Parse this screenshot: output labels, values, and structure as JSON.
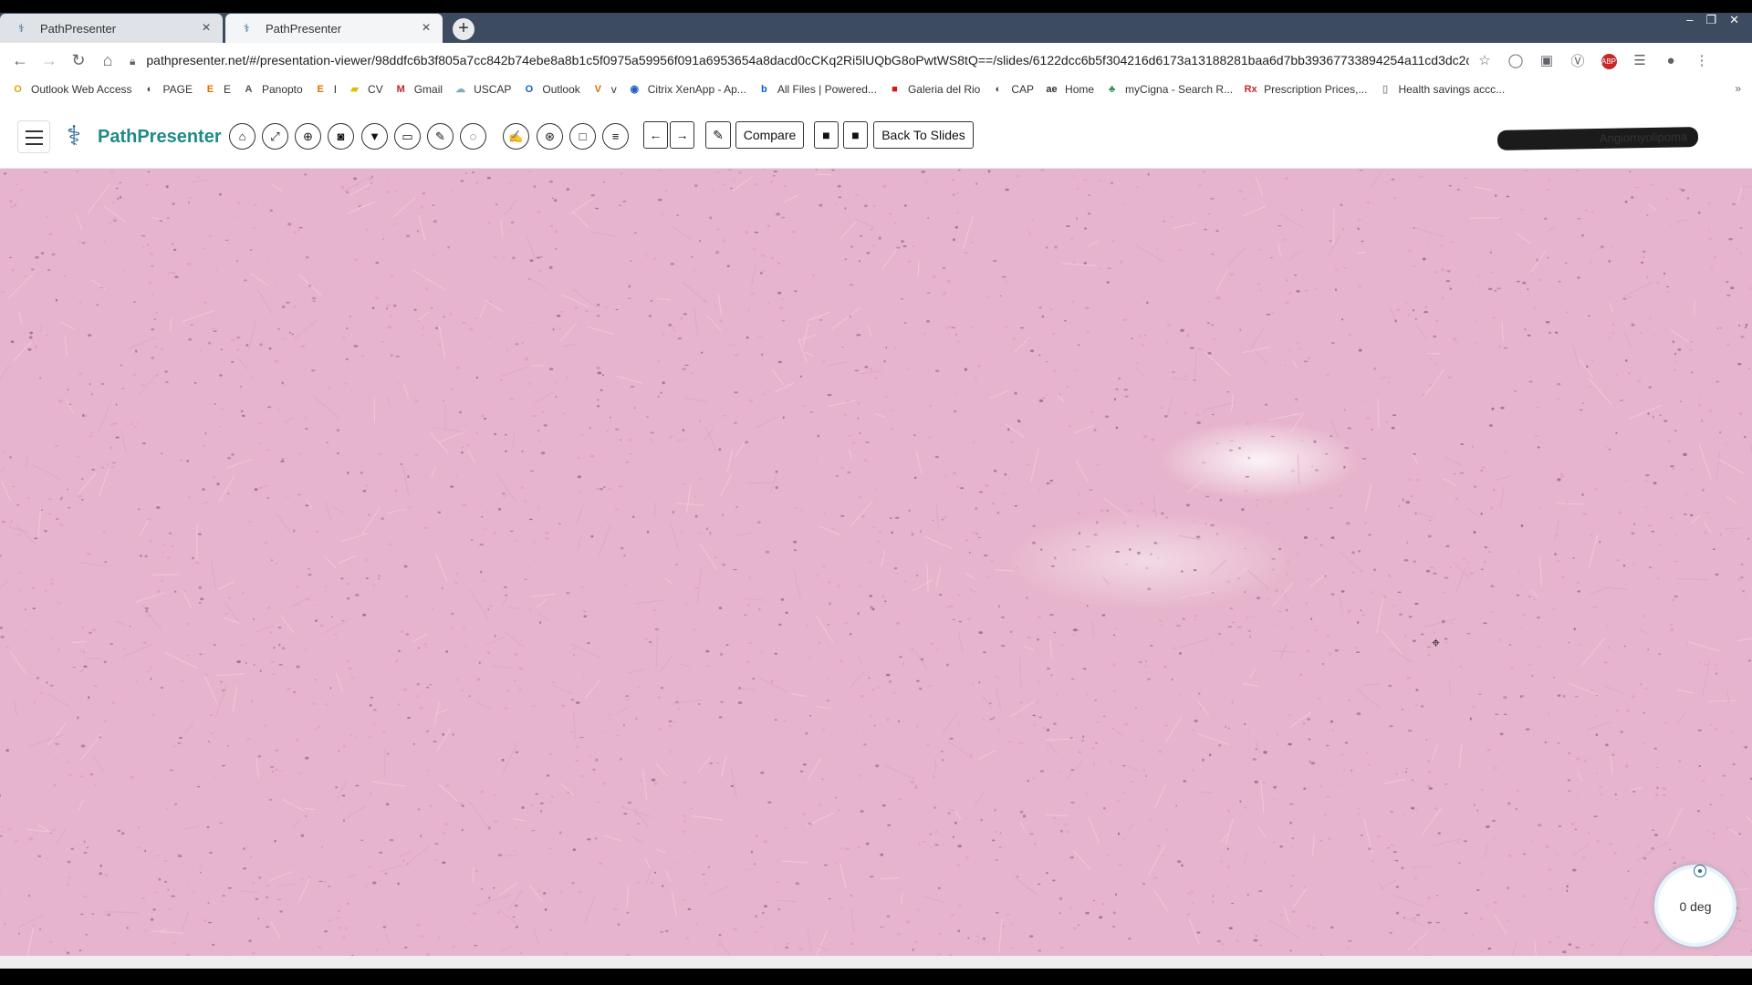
{
  "browser": {
    "tabs": [
      {
        "title": "PathPresenter",
        "close": "×"
      },
      {
        "title": "PathPresenter",
        "close": "×"
      }
    ],
    "new_tab": "+",
    "window_controls": [
      "–",
      "❐",
      "✕"
    ],
    "url": "pathpresenter.net/#/presentation-viewer/98ddfc6b3f805a7cc842b74ebe8a8b1c5f0975a59956f091a6953654a8dacd0cCKq2Ri5lUQbG8oPwtWS8tQ==/slides/6122dcc6b5f304216d6173a13188281baa6d7bb39367733894254a11cd3dc2ce...",
    "bookmarks": [
      {
        "label": "Outlook Web Access",
        "icon": "O",
        "color": "#e0a800"
      },
      {
        "label": "PAGE",
        "icon": "◐",
        "color": "#444"
      },
      {
        "label": "E",
        "icon": "E",
        "color": "#e07000"
      },
      {
        "label": "Panopto",
        "icon": "A",
        "color": "#555"
      },
      {
        "label": "I",
        "icon": "E",
        "color": "#e07000"
      },
      {
        "label": "CV",
        "icon": "▰",
        "color": "#e6b800"
      },
      {
        "label": "Gmail",
        "icon": "M",
        "color": "#c5221f"
      },
      {
        "label": "USCAP",
        "icon": "☁",
        "color": "#8ab"
      },
      {
        "label": "Outlook",
        "icon": "O",
        "color": "#0a64c8"
      },
      {
        "label": "v",
        "icon": "V",
        "color": "#e06a00"
      },
      {
        "label": "Citrix XenApp - Ap...",
        "icon": "◉",
        "color": "#1f5fbf"
      },
      {
        "label": "All Files | Powered...",
        "icon": "b",
        "color": "#0061d5"
      },
      {
        "label": "Galeria del Rio",
        "icon": "■",
        "color": "#d11"
      },
      {
        "label": "CAP",
        "icon": "◐",
        "color": "#444"
      },
      {
        "label": "Home",
        "icon": "ae",
        "color": "#333"
      },
      {
        "label": "myCigna - Search R...",
        "icon": "♣",
        "color": "#2e8b57"
      },
      {
        "label": "Prescription Prices,...",
        "icon": "Rx",
        "color": "#c62828"
      },
      {
        "label": "Health savings accc...",
        "icon": "▯",
        "color": "#999"
      }
    ],
    "bookmarks_more": "»"
  },
  "app": {
    "logo_text": "PathPresenter",
    "toolbar": {
      "compare_label": "Compare",
      "back_label": "Back To Slides"
    },
    "slide_name": "Angiomyolipoma"
  },
  "viewer": {
    "rotation_label": "0 deg"
  },
  "icons": {
    "home": "⌂",
    "fullscreen": "⤢",
    "zoom": "⊕",
    "camera": "◙",
    "filter": "▼",
    "monitor": "▭",
    "pen": "✎",
    "lasso": "◌",
    "annotate": "✍",
    "sync": "⊛",
    "square": "□",
    "list": "≡",
    "prev": "←",
    "next": "→",
    "attach": "✎",
    "video": "■",
    "stop": "■"
  }
}
